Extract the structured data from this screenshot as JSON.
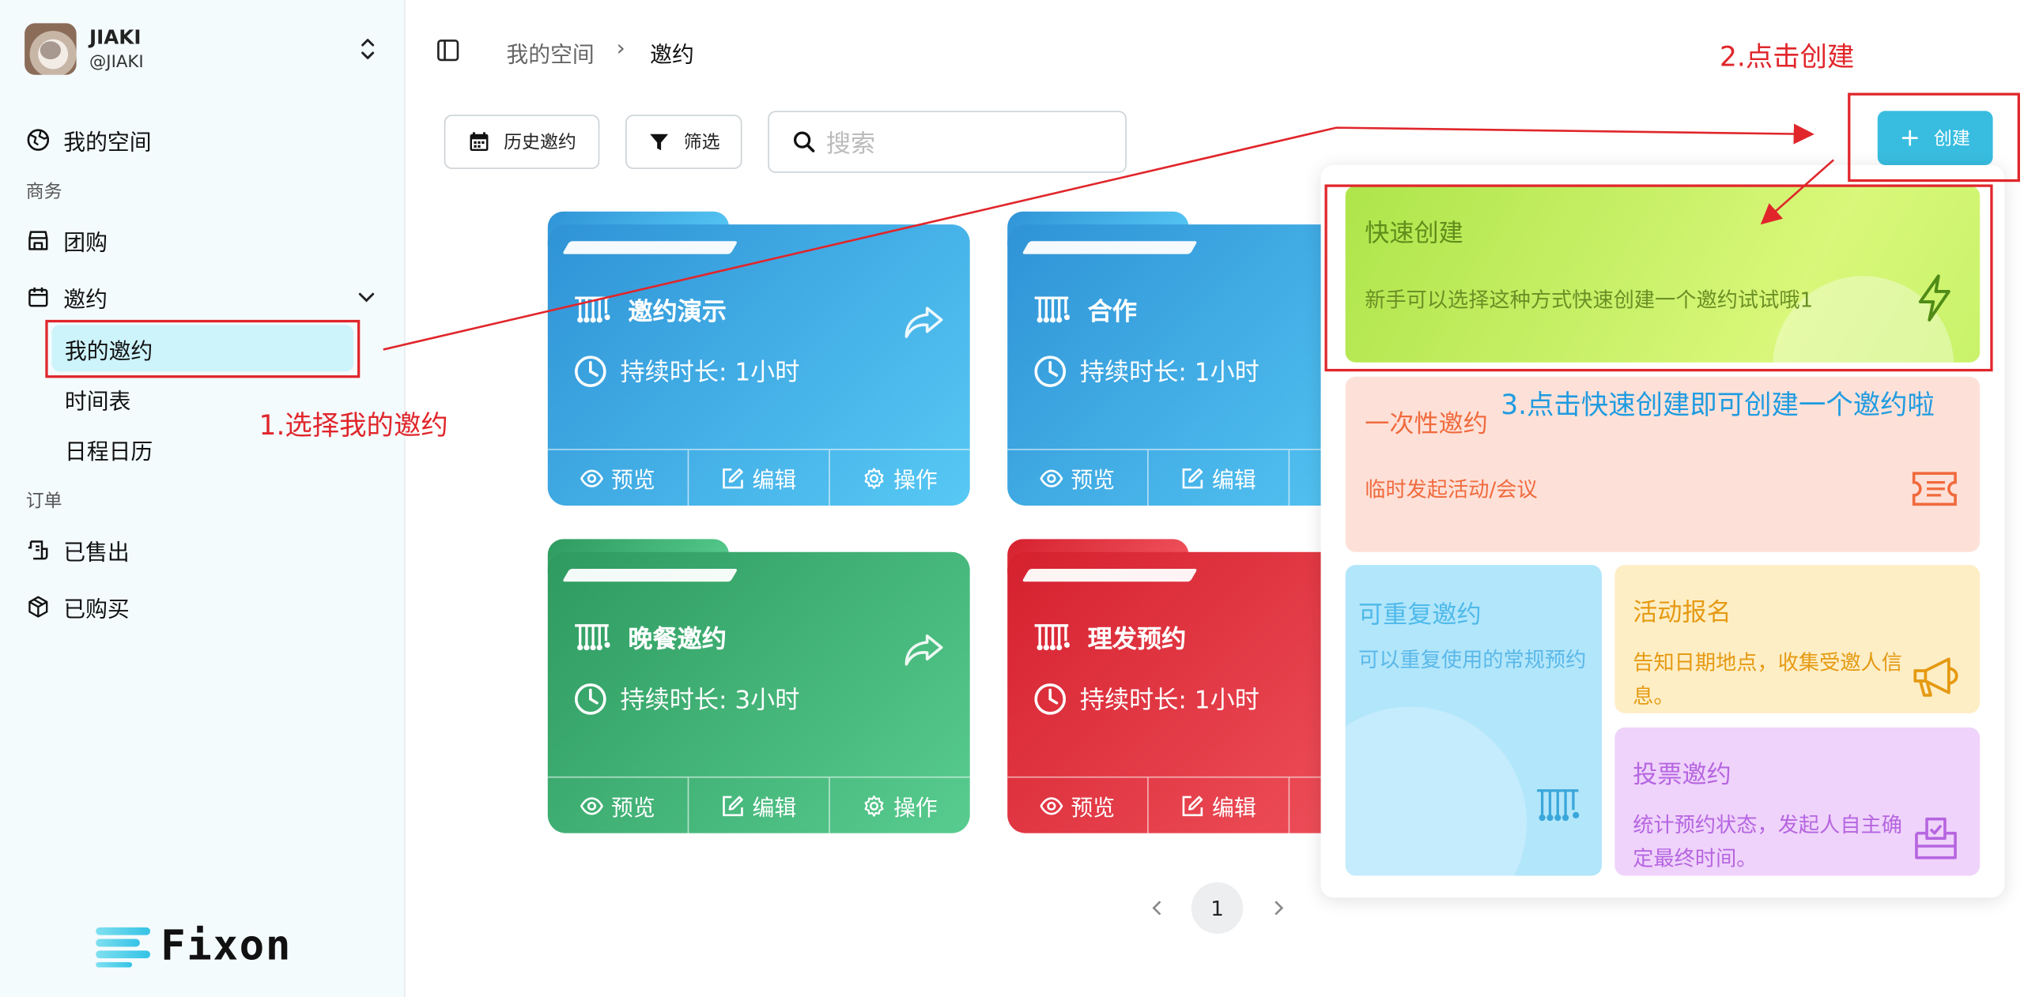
{
  "user": {
    "name": "JIAKI",
    "handle": "@JIAKI"
  },
  "sidebar": {
    "my_space": "我的空间",
    "section_business": "商务",
    "group_buy": "团购",
    "invitations": "邀约",
    "sub_items": [
      "我的邀约",
      "时间表",
      "日程日历"
    ],
    "section_orders": "订单",
    "sold": "已售出",
    "purchased": "已购买"
  },
  "logo": {
    "text": "Fixon"
  },
  "breadcrumb": {
    "root": "我的空间",
    "separator": "›",
    "current": "邀约"
  },
  "toolbar": {
    "history": "历史邀约",
    "filter": "筛选",
    "search_placeholder": "搜索",
    "create": "创建"
  },
  "cards": [
    {
      "title": "邀约演示",
      "duration": "持续时长: 1小时",
      "color": "blue"
    },
    {
      "title": "合作",
      "duration": "持续时长: 1小时",
      "color": "blue"
    },
    {
      "title": "晚餐邀约",
      "duration": "持续时长: 3小时",
      "color": "green"
    },
    {
      "title": "理发预约",
      "duration": "持续时长: 1小时",
      "color": "red"
    }
  ],
  "card_actions": {
    "preview": "预览",
    "edit": "编辑",
    "operate": "操作"
  },
  "pagination": {
    "current": "1"
  },
  "create_menu": {
    "quick": {
      "title": "快速创建",
      "desc": "新手可以选择这种方式快速创建一个邀约试试哦1"
    },
    "one_time": {
      "title": "一次性邀约",
      "desc": "临时发起活动/会议"
    },
    "repeat": {
      "title": "可重复邀约",
      "desc": "可以重复使用的常规预约"
    },
    "event": {
      "title": "活动报名",
      "desc": "告知日期地点，收集受邀人信息。"
    },
    "vote": {
      "title": "投票邀约",
      "desc": "统计预约状态，发起人自主确定最终时间。"
    }
  },
  "annotations": {
    "step1": "1.选择我的邀约",
    "step2": "2.点击创建",
    "step3": "3.点击快速创建即可创建一个邀约啦"
  },
  "colors": {
    "accent": "#38bde0",
    "annotation_red": "#e0262b",
    "annotation_blue": "#1f9be0",
    "card_blue": "#3aa8e6",
    "card_green": "#3cb474",
    "card_red": "#e23a44"
  }
}
